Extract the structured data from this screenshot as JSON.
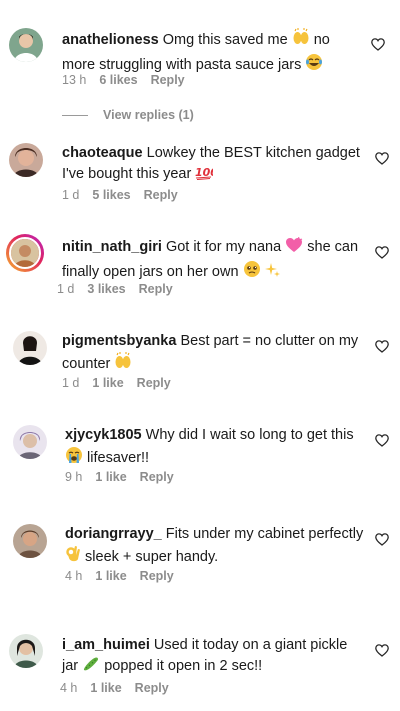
{
  "comments": [
    {
      "username": "anathelioness",
      "text_1": "Omg this saved me",
      "text_2": "no more struggling with pasta sauce jars",
      "time": "13 h",
      "likes": "6 likes",
      "reply": "Reply",
      "view_replies": "View replies (1)"
    },
    {
      "username": "chaoteaque",
      "text_1": "Lowkey the BEST kitchen gadget I've bought this year",
      "time": "1 d",
      "likes": "5 likes",
      "reply": "Reply"
    },
    {
      "username": "nitin_nath_giri",
      "text_1": "Got it for my nana",
      "text_2": "she can finally open jars on her own",
      "time": "1 d",
      "likes": "3 likes",
      "reply": "Reply"
    },
    {
      "username": "pigmentsbyanka",
      "text_1": "Best part = no clutter on my counter",
      "time": "1 d",
      "likes": "1 like",
      "reply": "Reply"
    },
    {
      "username": "xjycyk1805",
      "text_1": "Why did I wait so long to get this",
      "text_2": "lifesaver!!",
      "time": "9 h",
      "likes": "1 like",
      "reply": "Reply"
    },
    {
      "username": "doriangrrayy_",
      "text_1": "Fits under my cabinet perfectly",
      "text_2": "sleek + super handy.",
      "time": "4 h",
      "likes": "1 like",
      "reply": "Reply"
    },
    {
      "username": "i_am_huimei",
      "text_1": "Used it today on a giant pickle jar",
      "text_2": "popped it open in 2 sec!!",
      "time": "4 h",
      "likes": "1 like",
      "reply": "Reply"
    }
  ],
  "icons": {
    "like": "heart-outline-icon",
    "emoji_raising_hands": "raising-hands-emoji",
    "emoji_laughing": "tears-of-joy-emoji",
    "emoji_hundred": "hundred-points-emoji",
    "emoji_heart": "pink-heart-emoji",
    "emoji_teary_smile": "holding-back-tears-emoji",
    "emoji_sparkles": "sparkles-emoji",
    "emoji_crying": "loudly-crying-emoji",
    "emoji_ok": "ok-hand-emoji",
    "emoji_cucumber": "cucumber-emoji"
  },
  "colors": {
    "text": "#1a1a1a",
    "muted": "#8c8c8c",
    "background": "#ffffff"
  }
}
